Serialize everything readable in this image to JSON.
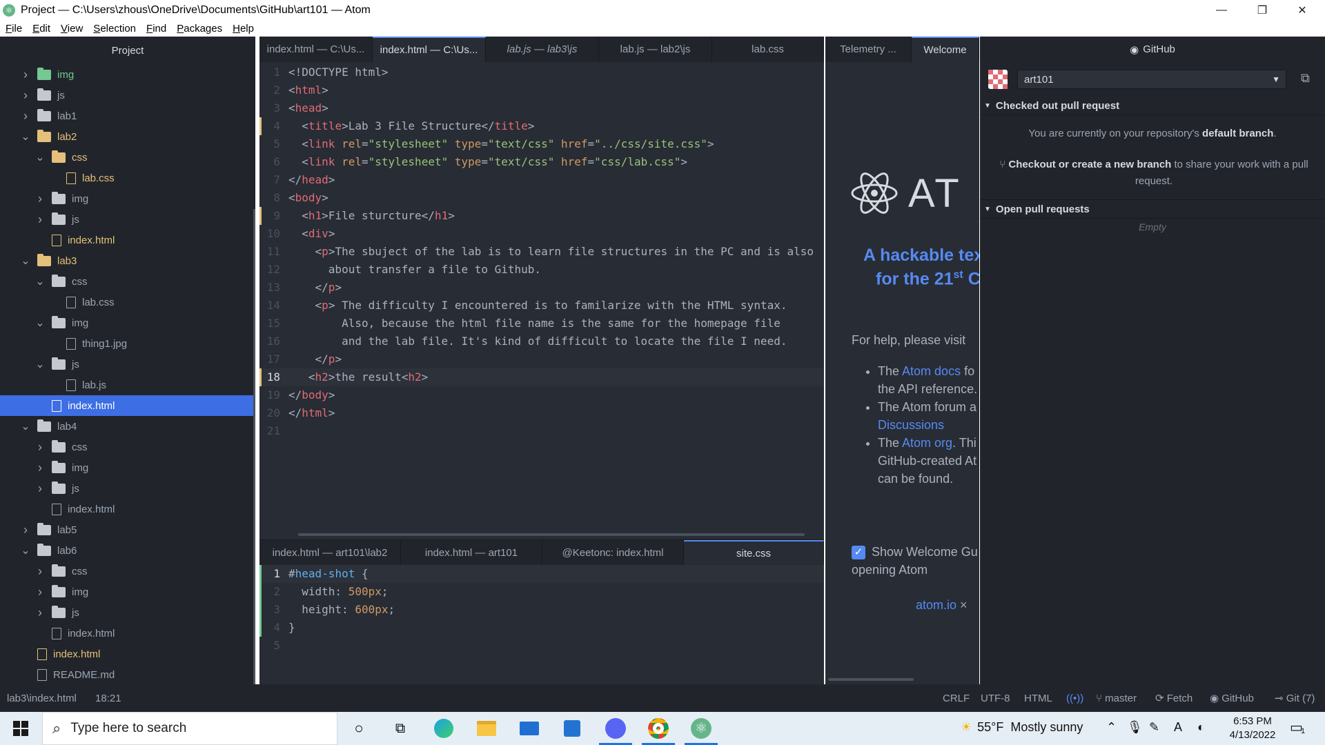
{
  "window": {
    "title": "Project — C:\\Users\\zhous\\OneDrive\\Documents\\GitHub\\art101 — Atom"
  },
  "menu": [
    "File",
    "Edit",
    "View",
    "Selection",
    "Find",
    "Packages",
    "Help"
  ],
  "tree": {
    "header": "Project",
    "items": [
      {
        "label": "img",
        "type": "folder",
        "depth": 1,
        "expanded": false,
        "color": "green"
      },
      {
        "label": "js",
        "type": "folder",
        "depth": 1,
        "expanded": false
      },
      {
        "label": "lab1",
        "type": "folder",
        "depth": 1,
        "expanded": false
      },
      {
        "label": "lab2",
        "type": "folder",
        "depth": 1,
        "expanded": true,
        "color": "yellow"
      },
      {
        "label": "css",
        "type": "folder",
        "depth": 2,
        "expanded": true,
        "color": "yellow"
      },
      {
        "label": "lab.css",
        "type": "file",
        "depth": 3,
        "color": "yellow"
      },
      {
        "label": "img",
        "type": "folder",
        "depth": 2,
        "expanded": false
      },
      {
        "label": "js",
        "type": "folder",
        "depth": 2,
        "expanded": false
      },
      {
        "label": "index.html",
        "type": "file",
        "depth": 2,
        "color": "yellow"
      },
      {
        "label": "lab3",
        "type": "folder",
        "depth": 1,
        "expanded": true,
        "color": "yellow"
      },
      {
        "label": "css",
        "type": "folder",
        "depth": 2,
        "expanded": true
      },
      {
        "label": "lab.css",
        "type": "file",
        "depth": 3
      },
      {
        "label": "img",
        "type": "folder",
        "depth": 2,
        "expanded": true
      },
      {
        "label": "thing1.jpg",
        "type": "image",
        "depth": 3
      },
      {
        "label": "js",
        "type": "folder",
        "depth": 2,
        "expanded": true
      },
      {
        "label": "lab.js",
        "type": "file",
        "depth": 3
      },
      {
        "label": "index.html",
        "type": "file",
        "depth": 2,
        "selected": true
      },
      {
        "label": "lab4",
        "type": "folder",
        "depth": 1,
        "expanded": true
      },
      {
        "label": "css",
        "type": "folder",
        "depth": 2,
        "expanded": false
      },
      {
        "label": "img",
        "type": "folder",
        "depth": 2,
        "expanded": false
      },
      {
        "label": "js",
        "type": "folder",
        "depth": 2,
        "expanded": false
      },
      {
        "label": "index.html",
        "type": "file",
        "depth": 2
      },
      {
        "label": "lab5",
        "type": "folder",
        "depth": 1,
        "expanded": false
      },
      {
        "label": "lab6",
        "type": "folder",
        "depth": 1,
        "expanded": true
      },
      {
        "label": "css",
        "type": "folder",
        "depth": 2,
        "expanded": false
      },
      {
        "label": "img",
        "type": "folder",
        "depth": 2,
        "expanded": false
      },
      {
        "label": "js",
        "type": "folder",
        "depth": 2,
        "expanded": false
      },
      {
        "label": "index.html",
        "type": "file",
        "depth": 2
      },
      {
        "label": "index.html",
        "type": "file",
        "depth": 1,
        "color": "yellow"
      },
      {
        "label": "README.md",
        "type": "readme",
        "depth": 1
      }
    ]
  },
  "editor_top": {
    "tabs": [
      {
        "label": "index.html — C:\\Us...",
        "active": false
      },
      {
        "label": "index.html — C:\\Us...",
        "active": true
      },
      {
        "label": "lab.js — lab3\\js",
        "active": false,
        "italic": true
      },
      {
        "label": "lab.js — lab2\\js",
        "active": false
      },
      {
        "label": "lab.css",
        "active": false
      }
    ],
    "lines": [
      [
        [
          "c",
          "<!DOCTYPE html>"
        ]
      ],
      [
        [
          "c",
          "<"
        ],
        [
          "t",
          "html"
        ],
        [
          "c",
          ">"
        ]
      ],
      [
        [
          "c",
          "<"
        ],
        [
          "t",
          "head"
        ],
        [
          "c",
          ">"
        ]
      ],
      [
        [
          "c",
          "  <"
        ],
        [
          "t",
          "title"
        ],
        [
          "c",
          ">Lab 3 File Structure</"
        ],
        [
          "t",
          "title"
        ],
        [
          "c",
          ">"
        ]
      ],
      [
        [
          "c",
          "  <"
        ],
        [
          "t",
          "link"
        ],
        [
          "c",
          " "
        ],
        [
          "a",
          "rel"
        ],
        [
          "c",
          "="
        ],
        [
          "s",
          "\"stylesheet\""
        ],
        [
          "c",
          " "
        ],
        [
          "a",
          "type"
        ],
        [
          "c",
          "="
        ],
        [
          "s",
          "\"text/css\""
        ],
        [
          "c",
          " "
        ],
        [
          "a",
          "href"
        ],
        [
          "c",
          "="
        ],
        [
          "s",
          "\"../css/site.css\""
        ],
        [
          "c",
          ">"
        ]
      ],
      [
        [
          "c",
          "  <"
        ],
        [
          "t",
          "link"
        ],
        [
          "c",
          " "
        ],
        [
          "a",
          "rel"
        ],
        [
          "c",
          "="
        ],
        [
          "s",
          "\"stylesheet\""
        ],
        [
          "c",
          " "
        ],
        [
          "a",
          "type"
        ],
        [
          "c",
          "="
        ],
        [
          "s",
          "\"text/css\""
        ],
        [
          "c",
          " "
        ],
        [
          "a",
          "href"
        ],
        [
          "c",
          "="
        ],
        [
          "s",
          "\"css/lab.css\""
        ],
        [
          "c",
          ">"
        ]
      ],
      [
        [
          "c",
          "</"
        ],
        [
          "t",
          "head"
        ],
        [
          "c",
          ">"
        ]
      ],
      [
        [
          "c",
          "<"
        ],
        [
          "t",
          "body"
        ],
        [
          "c",
          ">"
        ]
      ],
      [
        [
          "c",
          "  <"
        ],
        [
          "t",
          "h1"
        ],
        [
          "c",
          ">File sturcture</"
        ],
        [
          "t",
          "h1"
        ],
        [
          "c",
          ">"
        ]
      ],
      [
        [
          "c",
          "  <"
        ],
        [
          "t",
          "div"
        ],
        [
          "c",
          ">"
        ]
      ],
      [
        [
          "c",
          "    <"
        ],
        [
          "t",
          "p"
        ],
        [
          "c",
          ">The sbuject of the lab is to learn file structures in the PC and is also"
        ]
      ],
      [
        [
          "c",
          "      about transfer a file to Github."
        ]
      ],
      [
        [
          "c",
          "    </"
        ],
        [
          "t",
          "p"
        ],
        [
          "c",
          ">"
        ]
      ],
      [
        [
          "c",
          "    <"
        ],
        [
          "t",
          "p"
        ],
        [
          "c",
          "> The difficulty I encountered is to familarize with the HTML syntax."
        ]
      ],
      [
        [
          "c",
          "        Also, because the html file name is the same for the homepage file"
        ]
      ],
      [
        [
          "c",
          "        and the lab file. It's kind of difficult to locate the file I need."
        ]
      ],
      [
        [
          "c",
          "    </"
        ],
        [
          "t",
          "p"
        ],
        [
          "c",
          ">"
        ]
      ],
      [
        [
          "c",
          "   <"
        ],
        [
          "t",
          "h2"
        ],
        [
          "c",
          ">the result<"
        ],
        [
          "t",
          "h2"
        ],
        [
          "c",
          ">"
        ]
      ],
      [
        [
          "c",
          "</"
        ],
        [
          "t",
          "body"
        ],
        [
          "c",
          ">"
        ]
      ],
      [
        [
          "c",
          "</"
        ],
        [
          "t",
          "html"
        ],
        [
          "c",
          ">"
        ]
      ],
      [
        [
          "c",
          ""
        ]
      ]
    ],
    "current_line": 18
  },
  "editor_bottom": {
    "tabs": [
      {
        "label": "index.html — art101\\lab2",
        "active": false
      },
      {
        "label": "index.html — art101",
        "active": false
      },
      {
        "label": "@Keetonc: index.html",
        "active": false
      },
      {
        "label": "site.css",
        "active": true
      }
    ],
    "lines": [
      [
        [
          "c",
          "#"
        ],
        [
          "k",
          "head-shot"
        ],
        [
          "c",
          " {"
        ]
      ],
      [
        [
          "c",
          "  width: "
        ],
        [
          "a",
          "500px"
        ],
        [
          "c",
          ";"
        ]
      ],
      [
        [
          "c",
          "  height: "
        ],
        [
          "a",
          "600px"
        ],
        [
          "c",
          ";"
        ]
      ],
      [
        [
          "c",
          "}"
        ]
      ],
      [
        [
          "c",
          ""
        ]
      ]
    ],
    "current_line": 1
  },
  "welcome": {
    "tabs": [
      {
        "label": "Telemetry ...",
        "active": false
      },
      {
        "label": "Welcome",
        "active": true
      }
    ],
    "logo_text": "AT",
    "headline_1": "A hackable tex",
    "headline_2a": "for the 21",
    "headline_sup": "st",
    "headline_2b": " C",
    "help_text": "For help, please visit",
    "bullet1_a": "The ",
    "bullet1_link": "Atom docs",
    "bullet1_b": " fo",
    "bullet1_c": "the API reference.",
    "bullet2_a": "The Atom forum a",
    "bullet2_link": "Discussions",
    "bullet3_a": "The ",
    "bullet3_link": "Atom org",
    "bullet3_b": ". Thi",
    "bullet3_c": "GitHub-created At",
    "bullet3_d": "can be found.",
    "checkbox_label_1": "Show Welcome Gu",
    "checkbox_label_2": "opening Atom",
    "footer_link": "atom.io",
    "footer_sep": "×"
  },
  "github": {
    "title": "GitHub",
    "repo": "art101",
    "section1": "Checked out pull request",
    "msg_a": "You are currently on your repository's ",
    "msg_b": "default branch",
    "msg_c": ".",
    "checkout_bold": "Checkout or create a new branch",
    "checkout_rest_1": " to share your work with a pull",
    "checkout_rest_2": "request.",
    "section2": "Open pull requests",
    "empty": "Empty"
  },
  "status": {
    "path": "lab3\\index.html",
    "cursor": "18:21",
    "eol": "CRLF",
    "encoding": "UTF-8",
    "grammar": "HTML",
    "branch": "master",
    "fetch": "Fetch",
    "github": "GitHub",
    "git": "Git (7)"
  },
  "taskbar": {
    "search_placeholder": "Type here to search",
    "temp": "55°F",
    "weather": "Mostly sunny",
    "time": "6:53 PM",
    "date": "4/13/2022",
    "notif_count": "1",
    "lang": "A"
  }
}
